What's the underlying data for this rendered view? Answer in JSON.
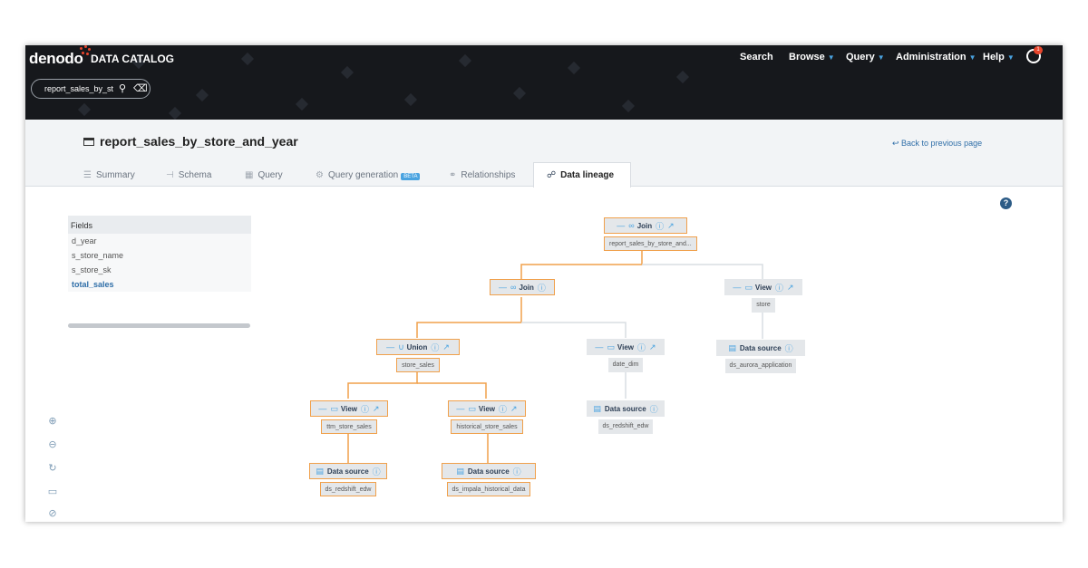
{
  "header": {
    "logo": "denodo",
    "product": "DATA CATALOG",
    "search_value": "report_sales_by_st",
    "nav": [
      "Search",
      "Browse",
      "Query",
      "Administration",
      "Help"
    ],
    "notification_count": "1"
  },
  "page": {
    "title": "report_sales_by_store_and_year",
    "back_label": "Back to previous page"
  },
  "tabs": [
    {
      "label": "Summary",
      "icon": "list-icon"
    },
    {
      "label": "Schema",
      "icon": "tree-icon"
    },
    {
      "label": "Query",
      "icon": "grid-icon"
    },
    {
      "label": "Query generation",
      "icon": "gear-icon",
      "badge": "BETA"
    },
    {
      "label": "Relationships",
      "icon": "link-icon"
    },
    {
      "label": "Data lineage",
      "icon": "lineage-icon",
      "active": true
    }
  ],
  "fields": {
    "header": "Fields",
    "items": [
      "d_year",
      "s_store_name",
      "s_store_sk",
      "total_sales"
    ],
    "selected": "total_sales"
  },
  "lineage": {
    "nodes": {
      "root": {
        "type": "Join",
        "label": "report_sales_by_store_and..."
      },
      "join2": {
        "type": "Join"
      },
      "view_store": {
        "type": "View",
        "label": "store"
      },
      "union": {
        "type": "Union",
        "label": "store_sales"
      },
      "view_date": {
        "type": "View",
        "label": "date_dim"
      },
      "ds_aurora": {
        "type": "Data source",
        "label": "ds_aurora_application"
      },
      "view_ttm": {
        "type": "View",
        "label": "ttm_store_sales"
      },
      "view_hist": {
        "type": "View",
        "label": "historical_store_sales"
      },
      "ds_redshift_date": {
        "type": "Data source",
        "label": "ds_redshift_edw"
      },
      "ds_redshift_ttm": {
        "type": "Data source",
        "label": "ds_redshift_edw"
      },
      "ds_impala": {
        "type": "Data source",
        "label": "ds_impala_historical_data"
      }
    },
    "colors": {
      "highlight": "#f0a04b",
      "edge": "#d9dde2",
      "accent": "#4aa3e0"
    }
  }
}
